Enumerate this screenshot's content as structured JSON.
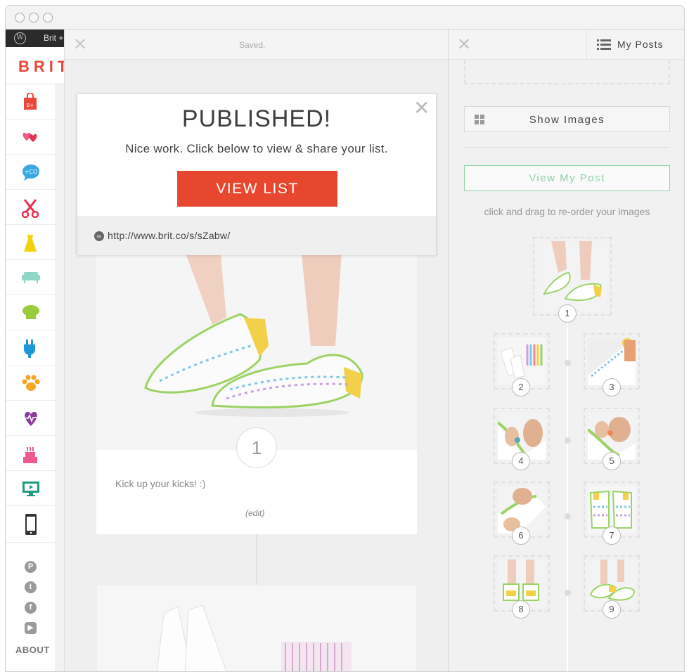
{
  "wordpress_bar": {
    "label": "Brit +"
  },
  "brand": {
    "logo": "BRIT"
  },
  "left_nav": {
    "icons": [
      "shopping-bag-icon",
      "hearts-icon",
      "speech-bubble-icon",
      "scissors-icon",
      "dress-icon",
      "sofa-icon",
      "chef-hat-icon",
      "plug-icon",
      "paw-icon",
      "heart-pulse-icon",
      "cake-icon",
      "monitor-icon",
      "phone-icon"
    ],
    "social": [
      "pinterest-icon",
      "twitter-icon",
      "facebook-icon",
      "youtube-icon"
    ],
    "about_label": "ABOUT"
  },
  "editor": {
    "status": "Saved.",
    "step_number": "1",
    "caption": "Kick up your kicks! :)",
    "edit_label": "(edit)"
  },
  "modal": {
    "title": "PUBLISHED!",
    "subtitle": "Nice work. Click below to view & share your list.",
    "button_label": "VIEW LIST",
    "url": "http://www.brit.co/s/sZabw/"
  },
  "right_panel": {
    "my_posts_label": "My Posts",
    "show_images_label": "Show Images",
    "view_post_label": "View My Post",
    "drag_hint": "click and drag to re-order your images",
    "thumbnails": [
      "1",
      "2",
      "3",
      "4",
      "5",
      "6",
      "7",
      "8",
      "9"
    ]
  },
  "colors": {
    "brand_red": "#e8473a",
    "button_red": "#e8472f",
    "accent_green": "#8fd3a8"
  }
}
